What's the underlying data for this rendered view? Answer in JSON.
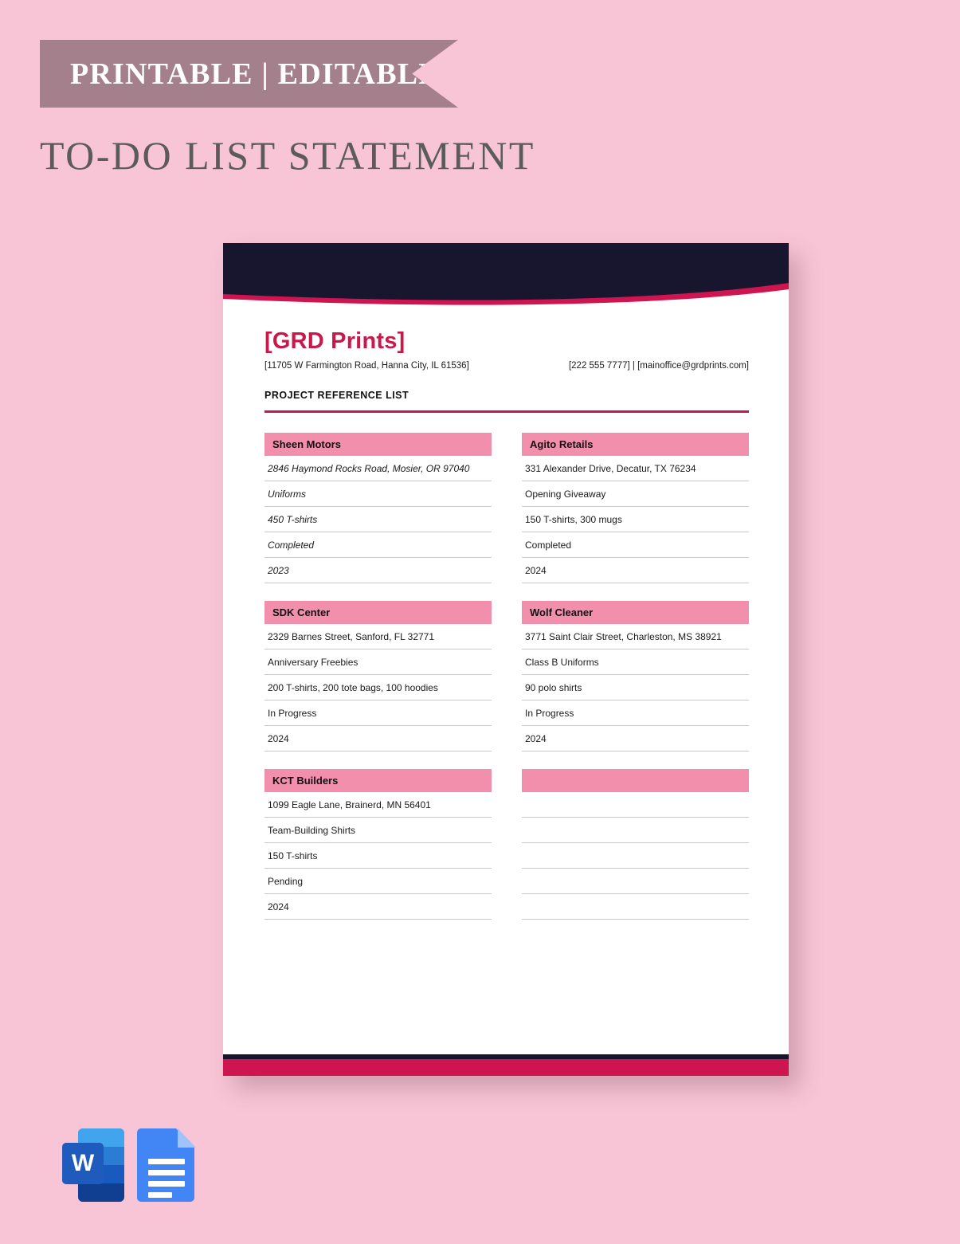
{
  "banner": {
    "label": "PRINTABLE | EDITABLE"
  },
  "page": {
    "title": "TO-DO LIST STATEMENT"
  },
  "colors": {
    "page_background": "#f7c5d5",
    "ribbon": "#a4808d",
    "header_navy": "#17162e",
    "accent_crimson": "#ce1550",
    "title_crimson": "#c9184a",
    "rule_crimson": "#c2185b",
    "entry_title_pink": "#f18fad",
    "row_divider": "#c9c9c9"
  },
  "letterhead": {
    "company_name": "[GRD Prints]",
    "address": "[11705 W Farmington Road, Hanna City, IL 61536]",
    "contact": "[222 555 7777] | [mainoffice@grdprints.com]",
    "section_heading": "PROJECT REFERENCE LIST"
  },
  "entries": {
    "left_column": [
      {
        "title": "Sheen Motors",
        "rows": [
          "2846 Haymond Rocks Road, Mosier, OR 97040",
          "Uniforms",
          "450 T-shirts",
          "Completed",
          "2023"
        ]
      },
      {
        "title": "SDK Center",
        "rows": [
          "2329 Barnes Street, Sanford, FL 32771",
          "Anniversary Freebies",
          "200 T-shirts, 200 tote bags, 100 hoodies",
          "In Progress",
          "2024"
        ]
      },
      {
        "title": "KCT Builders",
        "rows": [
          "1099 Eagle Lane, Brainerd, MN 56401",
          "Team-Building Shirts",
          "150 T-shirts",
          "Pending",
          "2024"
        ]
      }
    ],
    "right_column": [
      {
        "title": "Agito Retails",
        "rows": [
          "331 Alexander Drive, Decatur, TX 76234",
          "Opening Giveaway",
          "150 T-shirts, 300 mugs",
          "Completed",
          "2024"
        ]
      },
      {
        "title": "Wolf Cleaner",
        "rows": [
          "3771 Saint Clair Street, Charleston, MS 38921",
          "Class B Uniforms",
          "90 polo shirts",
          "In Progress",
          "2024"
        ]
      },
      {
        "title": "",
        "rows": [
          "",
          "",
          "",
          "",
          ""
        ]
      }
    ]
  },
  "format_icons": [
    {
      "name": "microsoft-word-icon",
      "letter": "W"
    },
    {
      "name": "google-docs-icon",
      "letter": ""
    }
  ]
}
